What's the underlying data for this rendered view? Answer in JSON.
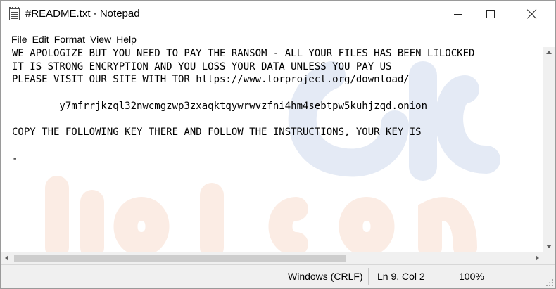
{
  "window": {
    "title": "#README.txt - Notepad"
  },
  "menu": [
    "File",
    "Edit",
    "Format",
    "View",
    "Help"
  ],
  "document": {
    "lines": [
      "WE APOLOGIZE BUT YOU NEED TO PAY THE RANSOM - ALL YOUR FILES HAS BEEN LILOCKED",
      "IT IS STRONG ENCRYPTION AND YOU LOSS YOUR DATA UNLESS YOU PAY US",
      "PLEASE VISIT OUR SITE WITH TOR https://www.torproject.org/download/",
      "",
      "        y7mfrrjkzql32nwcmgzwp3zxaqktqywrwvzfni4hm4sebtpw5kuhjzqd.onion",
      "",
      "COPY THE FOLLOWING KEY THERE AND FOLLOW THE INSTRUCTIONS, YOUR KEY IS",
      "",
      "-"
    ]
  },
  "status": {
    "line_endings": "Windows (CRLF)",
    "position": "Ln 9, Col 2",
    "zoom": "100%"
  },
  "icons": {
    "app": "notepad-icon",
    "minimize": "minimize-icon",
    "maximize": "maximize-icon",
    "close": "close-icon"
  },
  "colors": {
    "background": "#ffffff",
    "chrome": "#f0f0f0",
    "text": "#000000",
    "watermark": "#e9eef7"
  }
}
